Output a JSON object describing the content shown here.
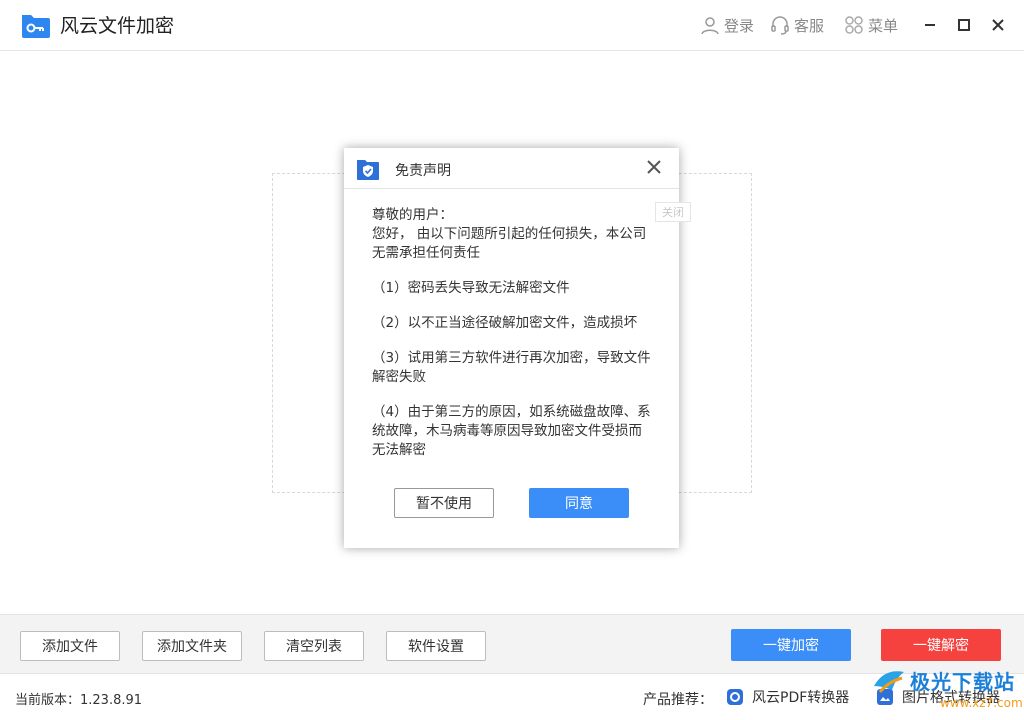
{
  "app": {
    "title": "风云文件加密",
    "accent": "#3b8ef7",
    "danger": "#f5423f"
  },
  "header": {
    "login_label": "登录",
    "service_label": "客服",
    "menu_label": "菜单"
  },
  "toolbar": {
    "add_file": "添加文件",
    "add_folder": "添加文件夹",
    "clear_list": "清空列表",
    "settings": "软件设置",
    "encrypt": "一键加密",
    "decrypt": "一键解密"
  },
  "status": {
    "version": "当前版本：1.23.8.91",
    "recommend_label": "产品推荐：",
    "rec_pdf": "风云PDF转换器",
    "rec_image": "图片格式转换器"
  },
  "watermark": {
    "text": "极光下载站",
    "url": "www.xz7.com"
  },
  "dialog": {
    "title": "免责声明",
    "close_tip": "关闭",
    "greeting": "尊敬的用户：",
    "intro": "您好， 由以下问题所引起的任何损失，本公司无需承担任何责任",
    "item1": "（1）密码丢失导致无法解密文件",
    "item2": "（2）以不正当途径破解加密文件，造成损坏",
    "item3": "（3）试用第三方软件进行再次加密，导致文件解密失败",
    "item4": "（4）由于第三方的原因，如系统磁盘故障、系统故障，木马病毒等原因导致加密文件受损而无法解密",
    "cancel": "暂不使用",
    "agree": "同意"
  }
}
